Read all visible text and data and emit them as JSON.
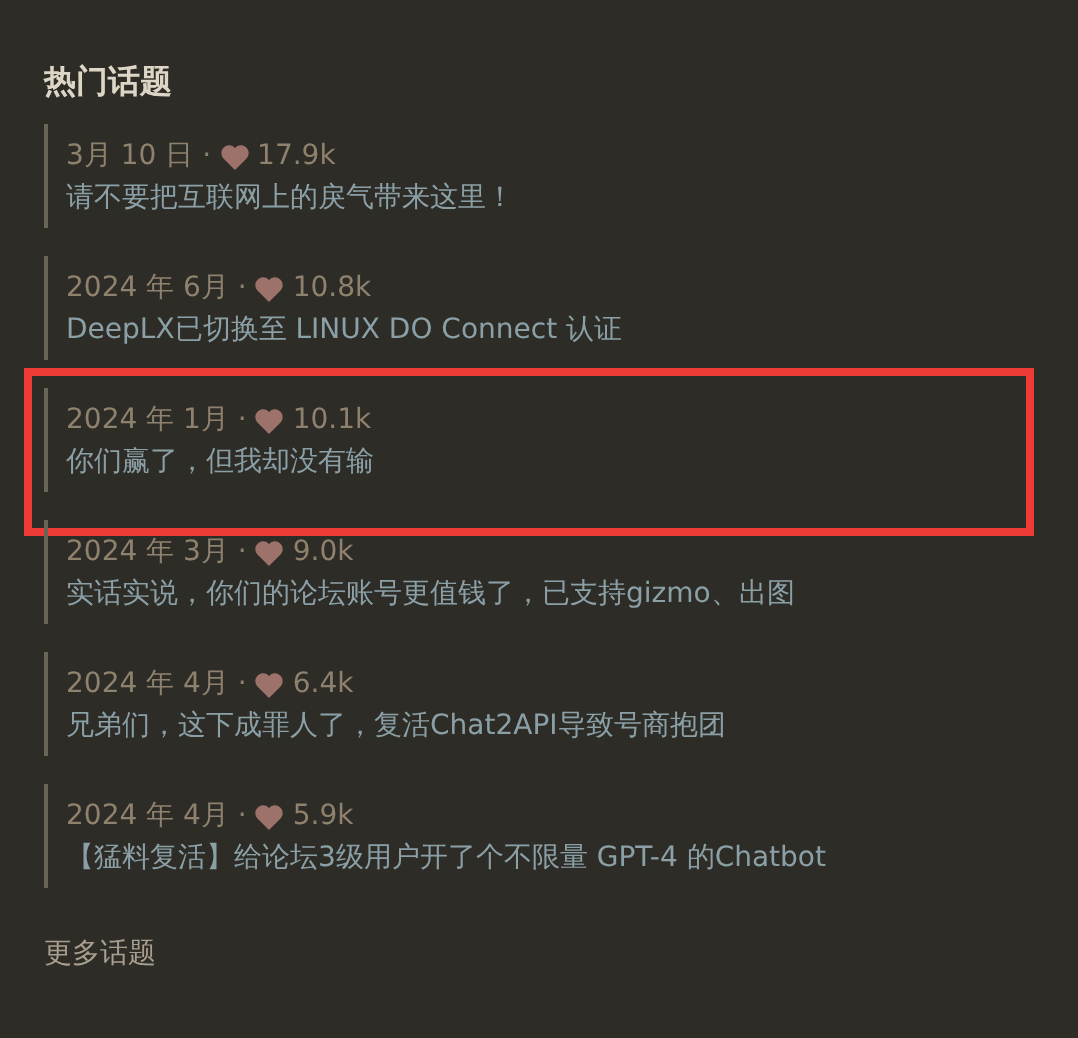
{
  "title": "热门话题",
  "topics": [
    {
      "date": "3月 10 日 ·",
      "likes": "17.9k",
      "title": "请不要把互联网上的戾气带来这里！",
      "highlighted": false
    },
    {
      "date": "2024 年 6月 ·",
      "likes": "10.8k",
      "title": "DeepLX已切换至 LINUX DO Connect 认证",
      "highlighted": false
    },
    {
      "date": "2024 年 1月 ·",
      "likes": "10.1k",
      "title": "你们赢了，但我却没有输",
      "highlighted": true
    },
    {
      "date": "2024 年 3月 ·",
      "likes": "9.0k",
      "title": "实话实说，你们的论坛账号更值钱了，已支持gizmo、出图",
      "highlighted": false
    },
    {
      "date": "2024 年 4月 ·",
      "likes": "6.4k",
      "title": "兄弟们，这下成罪人了，复活Chat2API导致号商抱团",
      "highlighted": false
    },
    {
      "date": "2024 年 4月 ·",
      "likes": "5.9k",
      "title": "【猛料复活】给论坛3级用户开了个不限量 GPT-4 的Chatbot",
      "highlighted": false
    }
  ],
  "more_link": "更多话题"
}
